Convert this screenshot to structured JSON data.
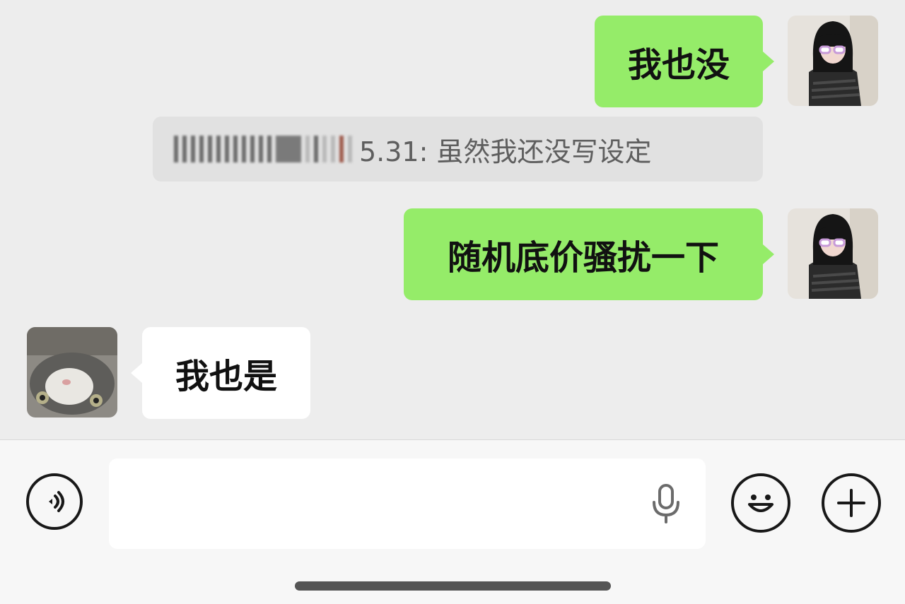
{
  "messages": [
    {
      "side": "right",
      "text": "我也没"
    },
    {
      "type": "quote",
      "sender": "",
      "text": "5.31: 虽然我还没写设定"
    },
    {
      "side": "right",
      "text": "随机底价骚扰一下"
    },
    {
      "side": "left",
      "text": "我也是"
    }
  ],
  "input": {
    "placeholder": ""
  },
  "colors": {
    "my_bubble": "#95ec69",
    "their_bubble": "#ffffff",
    "background": "#ededed",
    "quote_bg": "#e1e1e1"
  },
  "icons": {
    "voice": "voice-icon",
    "mic": "mic-icon",
    "emoji": "emoji-icon",
    "more": "plus-icon"
  }
}
